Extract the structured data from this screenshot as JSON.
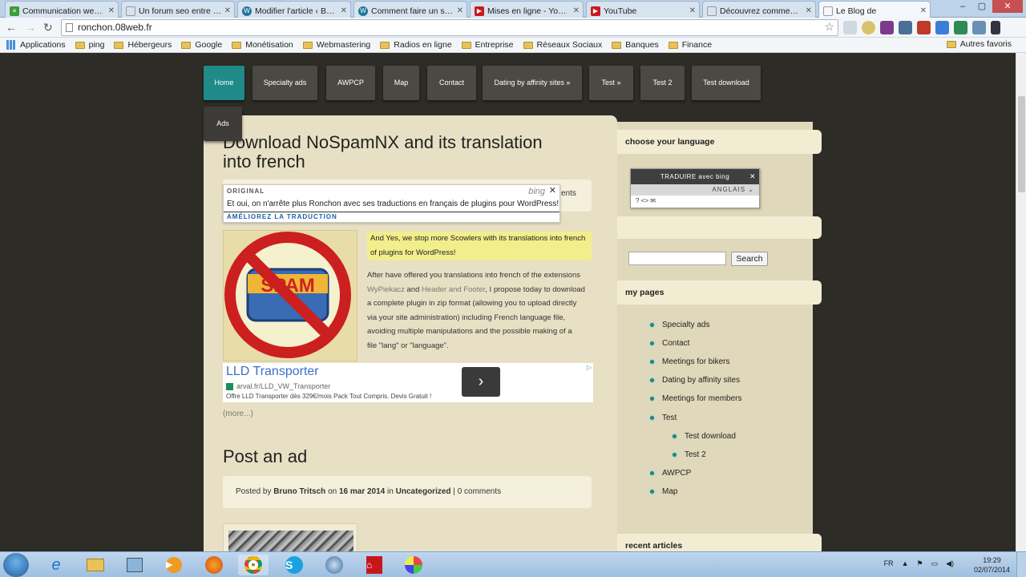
{
  "browser": {
    "tabs": [
      {
        "label": "Communication web pr",
        "icon": "green",
        "active": false
      },
      {
        "label": "Un forum seo entre ami",
        "icon": "blank",
        "active": false
      },
      {
        "label": "Modifier l'article ‹ BT W",
        "icon": "wordpress",
        "active": false
      },
      {
        "label": "Comment faire un site v",
        "icon": "wordpress",
        "active": false
      },
      {
        "label": "Mises en ligne - YouTul",
        "icon": "youtube",
        "active": false
      },
      {
        "label": "YouTube",
        "icon": "youtube",
        "active": false
      },
      {
        "label": "Découvrez comment fa",
        "icon": "blank",
        "active": false
      },
      {
        "label": "Le Blog de",
        "icon": "blank",
        "active": true
      }
    ],
    "address": "ronchon.08web.fr",
    "bookmarks": [
      "Applications",
      "ping",
      "Hébergeurs",
      "Google",
      "Monétisation",
      "Webmastering",
      "Radios en ligne",
      "Entreprise",
      "Réseaux Sociaux",
      "Banques",
      "Finance"
    ],
    "other_bookmarks": "Autres favoris"
  },
  "site": {
    "nav": [
      "Home",
      "Specialty ads",
      "AWPCP",
      "Map",
      "Contact",
      "Dating by affinity sites »",
      "Test »",
      "Test 2",
      "Test download",
      "Ads"
    ],
    "post1": {
      "title_line1": "Download NoSpamNX and its translation",
      "title_line2": "into french",
      "meta_tail": "ents",
      "image_word": "SPAM",
      "intro_line1": "And Yes, we stop more Scowlers with its translations into french",
      "intro_line2": "of plugins for WordPress!",
      "body": [
        "After have offered you translations into french of the extensions",
        "WyPiekacz and Header and Footer, I propose today to download",
        "a complete plugin in zip format (allowing you to upload directly",
        "via your site administration) including French language file,",
        "avoiding multiple manipulations and the possible making of a",
        "file \"lang\" or \"language\"."
      ],
      "body_link1": "WyPiekacz",
      "body_link2": "Header and Footer",
      "more": "(more...)"
    },
    "bing_popup": {
      "original_label": "ORIGINAL",
      "logo": "bing",
      "text": "Et oui, on n'arrête plus Ronchon avec ses traductions en français de plugins pour WordPress!",
      "improve": "AMÉLIOREZ LA TRADUCTION"
    },
    "ad": {
      "title": "LLD Transporter",
      "url": "arval.fr/LLD_VW_Transporter",
      "desc": "Offre LLD Transporter dès 329€/mois Pack Tout Compris. Devis Gratuit !",
      "arrow": "›"
    },
    "post2": {
      "title": "Post an ad",
      "posted_by": "Posted by",
      "author": "Bruno Tritsch",
      "on": "on",
      "date": "16 mar 2014",
      "in": "in",
      "category": "Uncategorized",
      "sep": "|",
      "comments": "0 comments"
    }
  },
  "sidebar": {
    "lang_heading": "choose your language",
    "bing_widget": {
      "top": "TRADUIRE avec bing",
      "lang": "ANGLAIS",
      "foot": "? <> ✉"
    },
    "search_button": "Search",
    "pages_heading": "my pages",
    "pages": [
      {
        "label": "Specialty ads",
        "level": 0
      },
      {
        "label": "Contact",
        "level": 0
      },
      {
        "label": "Meetings for bikers",
        "level": 0
      },
      {
        "label": "Dating by affinity sites",
        "level": 0
      },
      {
        "label": "Meetings for members",
        "level": 0
      },
      {
        "label": "Test",
        "level": 0
      },
      {
        "label": "Test download",
        "level": 1
      },
      {
        "label": "Test 2",
        "level": 1
      },
      {
        "label": "AWPCP",
        "level": 0
      },
      {
        "label": "Map",
        "level": 0
      }
    ],
    "recent_heading": "recent articles"
  },
  "taskbar": {
    "lang": "FR",
    "time": "19:29",
    "date": "02/07/2014"
  },
  "colors": {
    "page_bg": "#2d2c27",
    "content_bg": "#e8e0c4",
    "nav_active": "#1f8a87",
    "nav_bg": "#4a4944",
    "bullet": "#25837f"
  }
}
